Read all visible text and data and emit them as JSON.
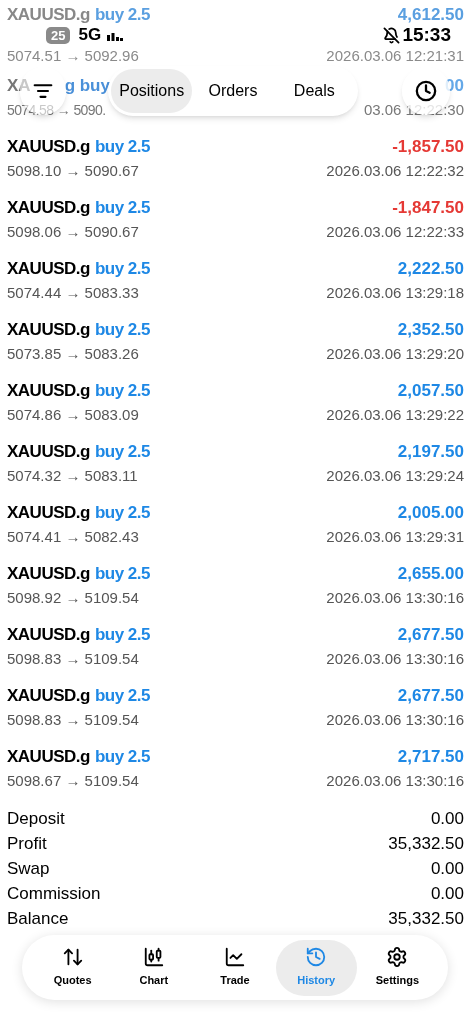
{
  "status_bar": {
    "battery": "25",
    "network": "5G",
    "time": "15:33",
    "muted": true
  },
  "toolbar": {
    "tabs": [
      {
        "label": "Positions",
        "selected": true
      },
      {
        "label": "Orders",
        "selected": false
      },
      {
        "label": "Deals",
        "selected": false
      }
    ]
  },
  "deals": [
    {
      "kind": "faded",
      "symbol": "XAUUSD.g",
      "side": "buy 2.5",
      "profit": "4,612.50",
      "loss": false,
      "prices": "5074.51 → 5092.96",
      "time": "2026.03.06 12:21:31"
    },
    {
      "kind": "covered",
      "symbol": "XA",
      "side": "g buy",
      "profit": "00",
      "loss": false,
      "prices": "5074.58 → 5090.",
      "time": "03.06 12:22:30"
    },
    {
      "kind": "plain",
      "symbol": "XAUUSD.g",
      "side": "buy 2.5",
      "profit": "-1,857.50",
      "loss": true,
      "prices": "5098.10 → 5090.67",
      "time": "2026.03.06 12:22:32"
    },
    {
      "kind": "plain",
      "symbol": "XAUUSD.g",
      "side": "buy 2.5",
      "profit": "-1,847.50",
      "loss": true,
      "prices": "5098.06 → 5090.67",
      "time": "2026.03.06 12:22:33"
    },
    {
      "kind": "plain",
      "symbol": "XAUUSD.g",
      "side": "buy 2.5",
      "profit": "2,222.50",
      "loss": false,
      "prices": "5074.44 → 5083.33",
      "time": "2026.03.06 13:29:18"
    },
    {
      "kind": "plain",
      "symbol": "XAUUSD.g",
      "side": "buy 2.5",
      "profit": "2,352.50",
      "loss": false,
      "prices": "5073.85 → 5083.26",
      "time": "2026.03.06 13:29:20"
    },
    {
      "kind": "plain",
      "symbol": "XAUUSD.g",
      "side": "buy 2.5",
      "profit": "2,057.50",
      "loss": false,
      "prices": "5074.86 → 5083.09",
      "time": "2026.03.06 13:29:22"
    },
    {
      "kind": "plain",
      "symbol": "XAUUSD.g",
      "side": "buy 2.5",
      "profit": "2,197.50",
      "loss": false,
      "prices": "5074.32 → 5083.11",
      "time": "2026.03.06 13:29:24"
    },
    {
      "kind": "plain",
      "symbol": "XAUUSD.g",
      "side": "buy 2.5",
      "profit": "2,005.00",
      "loss": false,
      "prices": "5074.41 → 5082.43",
      "time": "2026.03.06 13:29:31"
    },
    {
      "kind": "plain",
      "symbol": "XAUUSD.g",
      "side": "buy 2.5",
      "profit": "2,655.00",
      "loss": false,
      "prices": "5098.92 → 5109.54",
      "time": "2026.03.06 13:30:16"
    },
    {
      "kind": "plain",
      "symbol": "XAUUSD.g",
      "side": "buy 2.5",
      "profit": "2,677.50",
      "loss": false,
      "prices": "5098.83 → 5109.54",
      "time": "2026.03.06 13:30:16"
    },
    {
      "kind": "plain",
      "symbol": "XAUUSD.g",
      "side": "buy 2.5",
      "profit": "2,677.50",
      "loss": false,
      "prices": "5098.83 → 5109.54",
      "time": "2026.03.06 13:30:16"
    },
    {
      "kind": "plain",
      "symbol": "XAUUSD.g",
      "side": "buy 2.5",
      "profit": "2,717.50",
      "loss": false,
      "prices": "5098.67 → 5109.54",
      "time": "2026.03.06 13:30:16"
    }
  ],
  "summary": [
    {
      "label": "Deposit",
      "value": "0.00"
    },
    {
      "label": "Profit",
      "value": "35,332.50"
    },
    {
      "label": "Swap",
      "value": "0.00"
    },
    {
      "label": "Commission",
      "value": "0.00"
    },
    {
      "label": "Balance",
      "value": "35,332.50"
    }
  ],
  "nav": [
    {
      "label": "Quotes",
      "selected": false
    },
    {
      "label": "Chart",
      "selected": false
    },
    {
      "label": "Trade",
      "selected": false
    },
    {
      "label": "History",
      "selected": true
    },
    {
      "label": "Settings",
      "selected": false
    }
  ]
}
